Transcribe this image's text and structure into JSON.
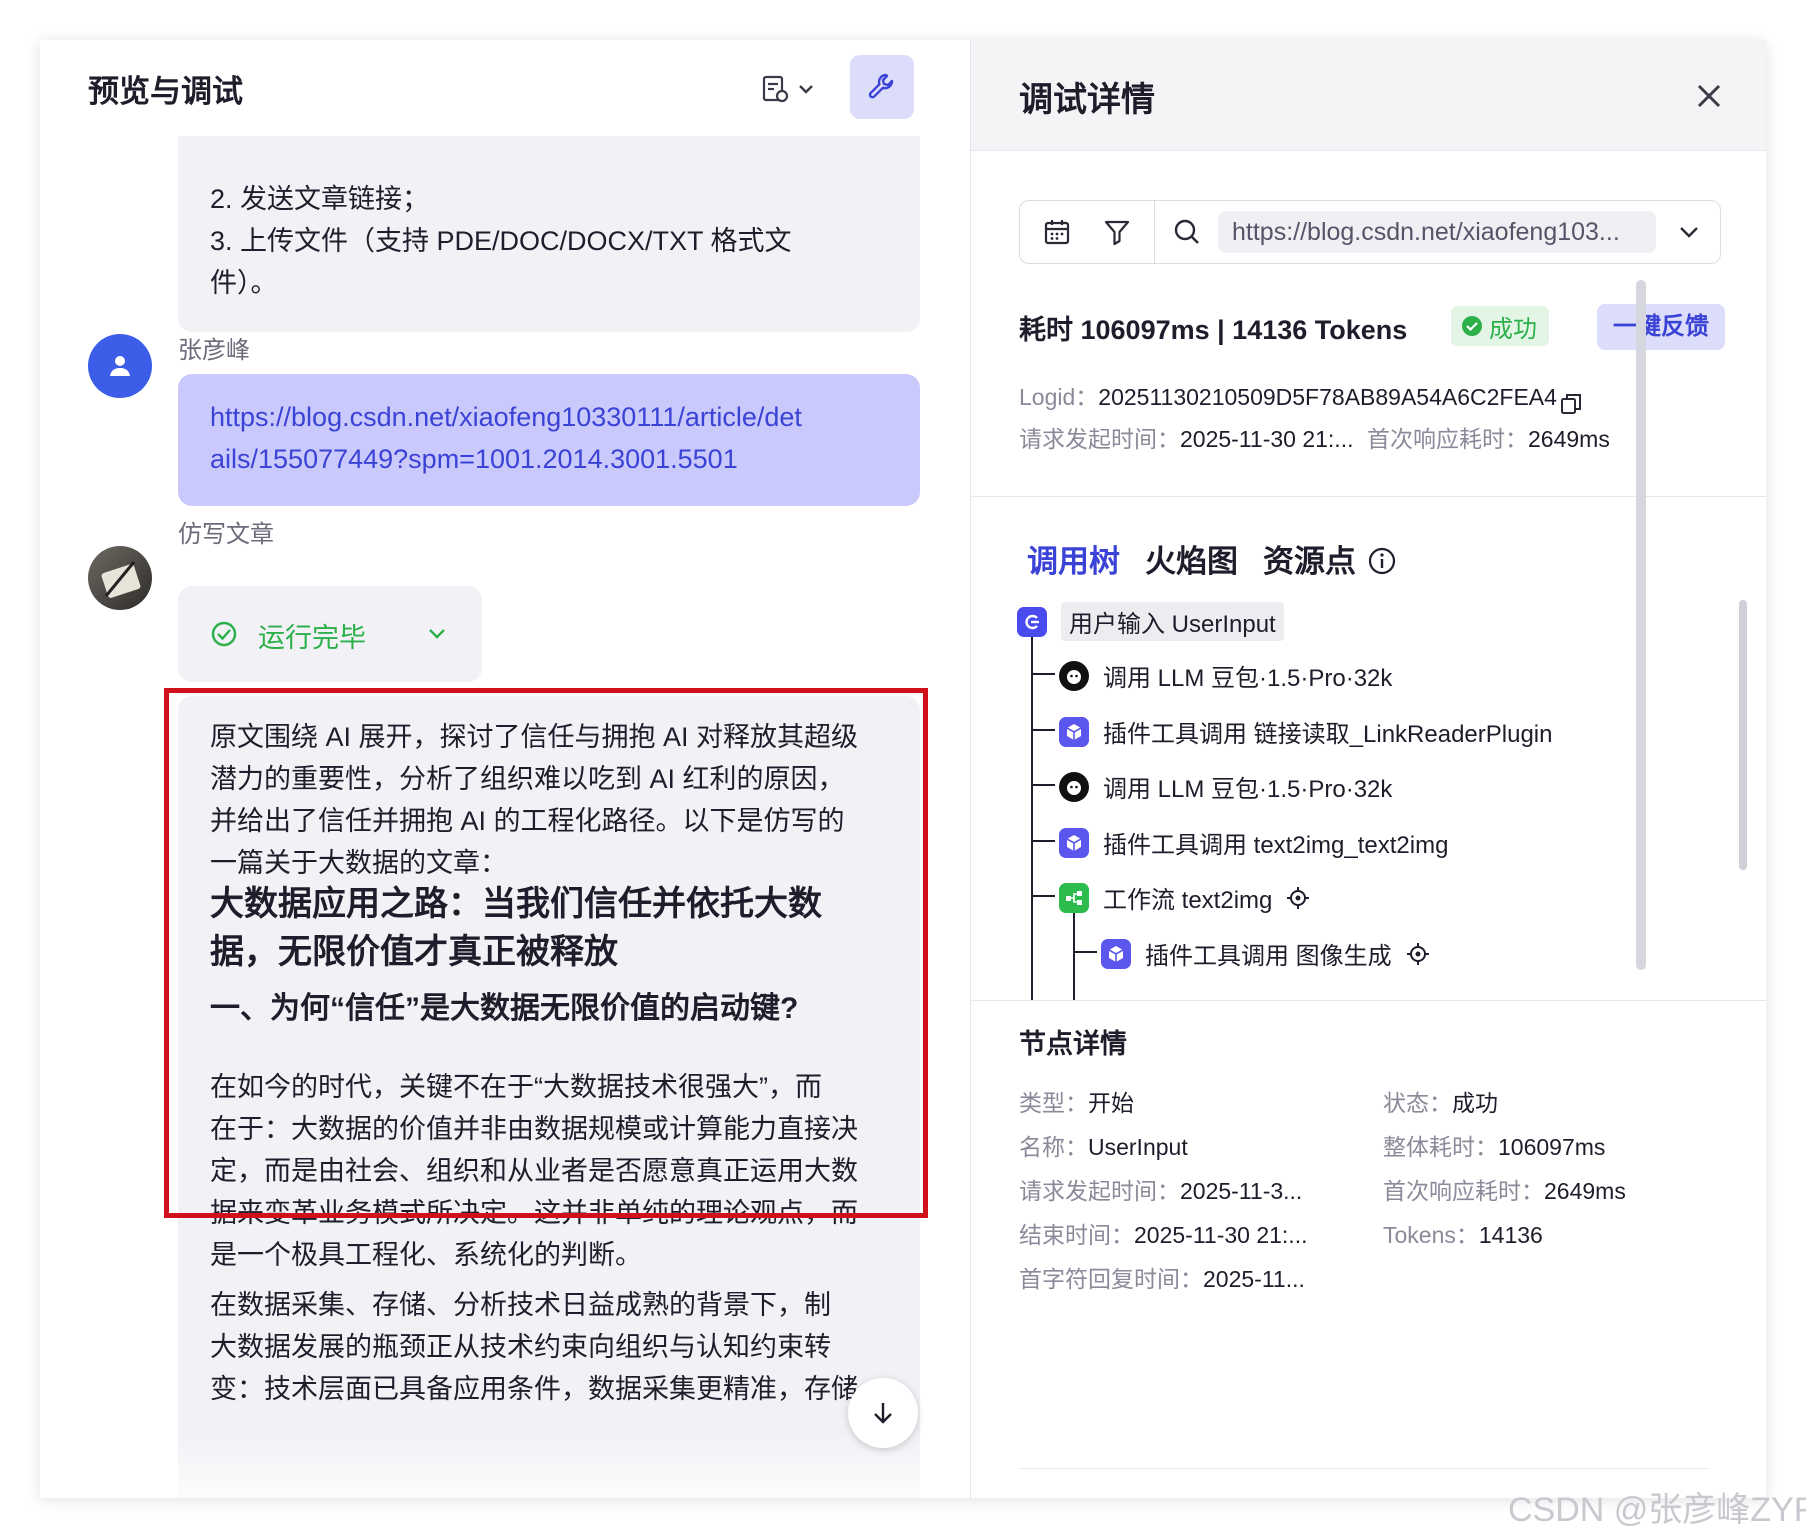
{
  "left": {
    "title": "预览与调试",
    "prev_message": {
      "line2": "2. 发送文章链接；",
      "line3a": "3. 上传文件（支持 PDE/DOC/DOCX/TXT 格式文",
      "line3b": "件）。"
    },
    "user": {
      "name": "张彦峰",
      "message_line1": "https://blog.csdn.net/xiaofeng10330111/article/det",
      "message_line2": "ails/155077449?spm=1001.2014.3001.5501"
    },
    "bot": {
      "name": "仿写文章",
      "status": "运行完毕",
      "answer": {
        "intro": [
          "原文围绕 AI 展开，探讨了信任与拥抱 AI 对释放其超级",
          "潜力的重要性，分析了组织难以吃到 AI 红利的原因，",
          "并给出了信任并拥抱 AI 的工程化路径。以下是仿写的",
          "一篇关于大数据的文章："
        ],
        "heading": [
          "大数据应用之路：当我们信任并依托大数",
          "据，无限价值才真正被释放"
        ],
        "subheading": "一、为何“信任”是大数据无限价值的启动键?",
        "para1": [
          "在如今的时代，关键不在于“大数据技术很强大”，而",
          "在于：大数据的价值并非由数据规模或计算能力直接决",
          "定，而是由社会、组织和从业者是否愿意真正运用大数",
          "据来变革业务模式所决定。这并非单纯的理论观点，而",
          "是一个极具工程化、系统化的判断。"
        ],
        "para2": [
          "在数据采集、存储、分析技术日益成熟的背景下，制",
          "大数据发展的瓶颈正从技术约束向组织与认知约束转",
          "变：技术层面已具备应用条件，数据采集更精准，存储"
        ]
      }
    }
  },
  "right": {
    "title": "调试详情",
    "search_value": "https://blog.csdn.net/xiaofeng103...",
    "metrics": "耗时 106097ms | 14136 Tokens",
    "status_badge": "成功",
    "feedback_button": "一键反馈",
    "logid_key": "Logid：",
    "logid_value": "20251130210509D5F78AB89A54A6C2FEA4",
    "request_time_key": "请求发起时间：",
    "request_time_value": "2025-11-30 21:...",
    "first_resp_key": "首次响应耗时：",
    "first_resp_value": "2649ms",
    "tabs": [
      "调用树",
      "火焰图",
      "资源点"
    ],
    "tree": [
      {
        "icon": "start-icon",
        "label": "用户输入 UserInput"
      },
      {
        "icon": "llm-icon",
        "label": "调用 LLM 豆包·1.5·Pro·32k"
      },
      {
        "icon": "plugin-icon",
        "label": "插件工具调用 链接读取_LinkReaderPlugin"
      },
      {
        "icon": "llm-icon",
        "label": "调用 LLM 豆包·1.5·Pro·32k"
      },
      {
        "icon": "plugin-icon",
        "label": "插件工具调用 text2img_text2img"
      },
      {
        "icon": "workflow-icon",
        "label": "工作流 text2img"
      },
      {
        "icon": "plugin-icon",
        "label": "插件工具调用 图像生成"
      }
    ],
    "node_details": {
      "title": "节点详情",
      "type_key": "类型：",
      "type_value": "开始",
      "status_key": "状态：",
      "status_value": "成功",
      "name_key": "名称：",
      "name_value": "UserInput",
      "total_key": "整体耗时：",
      "total_value": "106097ms",
      "req_key": "请求发起时间：",
      "req_value": "2025-11-3...",
      "first_key": "首次响应耗时：",
      "first_value": "2649ms",
      "end_key": "结束时间：",
      "end_value": "2025-11-30 21:...",
      "tokens_key": "Tokens：",
      "tokens_value": "14136",
      "ttft_key": "首字符回复时间：",
      "ttft_value": "2025-11..."
    }
  },
  "watermark": "CSDN @张彦峰ZYF",
  "colors": {
    "accent": "#3b42d6",
    "success": "#2bb04a",
    "highlight_box": "#d0101a"
  }
}
